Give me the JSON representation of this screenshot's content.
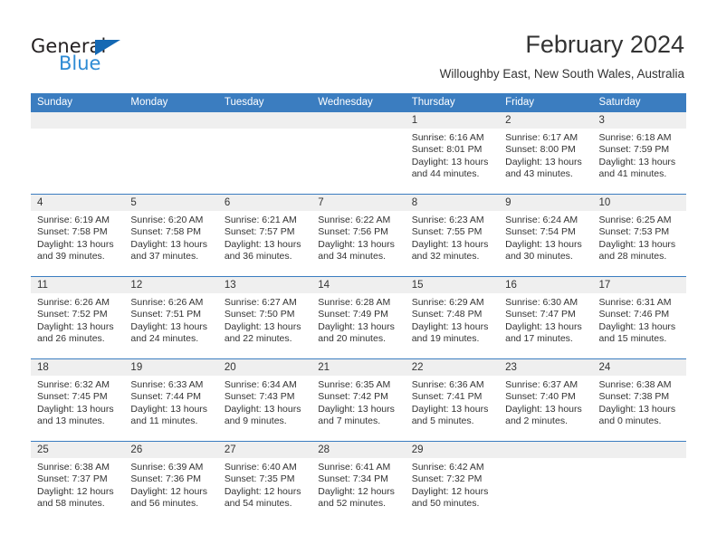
{
  "brand": {
    "name_dark": "General",
    "name_blue": "Blue",
    "accent_blue": "#2e8bd4",
    "triangle_blue": "#1468b3"
  },
  "header": {
    "month_title": "February 2024",
    "location": "Willoughby East, New South Wales, Australia"
  },
  "theme": {
    "header_row_bg": "#3b7dc0",
    "date_band_bg": "#efefef",
    "text_color": "#333333",
    "cell_bg": "#ffffff"
  },
  "weekdays": [
    "Sunday",
    "Monday",
    "Tuesday",
    "Wednesday",
    "Thursday",
    "Friday",
    "Saturday"
  ],
  "weeks": [
    {
      "days": [
        {
          "num": "",
          "lines": [
            "",
            "",
            "",
            ""
          ]
        },
        {
          "num": "",
          "lines": [
            "",
            "",
            "",
            ""
          ]
        },
        {
          "num": "",
          "lines": [
            "",
            "",
            "",
            ""
          ]
        },
        {
          "num": "",
          "lines": [
            "",
            "",
            "",
            ""
          ]
        },
        {
          "num": "1",
          "lines": [
            "Sunrise: 6:16 AM",
            "Sunset: 8:01 PM",
            "Daylight: 13 hours",
            "and 44 minutes."
          ]
        },
        {
          "num": "2",
          "lines": [
            "Sunrise: 6:17 AM",
            "Sunset: 8:00 PM",
            "Daylight: 13 hours",
            "and 43 minutes."
          ]
        },
        {
          "num": "3",
          "lines": [
            "Sunrise: 6:18 AM",
            "Sunset: 7:59 PM",
            "Daylight: 13 hours",
            "and 41 minutes."
          ]
        }
      ]
    },
    {
      "days": [
        {
          "num": "4",
          "lines": [
            "Sunrise: 6:19 AM",
            "Sunset: 7:58 PM",
            "Daylight: 13 hours",
            "and 39 minutes."
          ]
        },
        {
          "num": "5",
          "lines": [
            "Sunrise: 6:20 AM",
            "Sunset: 7:58 PM",
            "Daylight: 13 hours",
            "and 37 minutes."
          ]
        },
        {
          "num": "6",
          "lines": [
            "Sunrise: 6:21 AM",
            "Sunset: 7:57 PM",
            "Daylight: 13 hours",
            "and 36 minutes."
          ]
        },
        {
          "num": "7",
          "lines": [
            "Sunrise: 6:22 AM",
            "Sunset: 7:56 PM",
            "Daylight: 13 hours",
            "and 34 minutes."
          ]
        },
        {
          "num": "8",
          "lines": [
            "Sunrise: 6:23 AM",
            "Sunset: 7:55 PM",
            "Daylight: 13 hours",
            "and 32 minutes."
          ]
        },
        {
          "num": "9",
          "lines": [
            "Sunrise: 6:24 AM",
            "Sunset: 7:54 PM",
            "Daylight: 13 hours",
            "and 30 minutes."
          ]
        },
        {
          "num": "10",
          "lines": [
            "Sunrise: 6:25 AM",
            "Sunset: 7:53 PM",
            "Daylight: 13 hours",
            "and 28 minutes."
          ]
        }
      ]
    },
    {
      "days": [
        {
          "num": "11",
          "lines": [
            "Sunrise: 6:26 AM",
            "Sunset: 7:52 PM",
            "Daylight: 13 hours",
            "and 26 minutes."
          ]
        },
        {
          "num": "12",
          "lines": [
            "Sunrise: 6:26 AM",
            "Sunset: 7:51 PM",
            "Daylight: 13 hours",
            "and 24 minutes."
          ]
        },
        {
          "num": "13",
          "lines": [
            "Sunrise: 6:27 AM",
            "Sunset: 7:50 PM",
            "Daylight: 13 hours",
            "and 22 minutes."
          ]
        },
        {
          "num": "14",
          "lines": [
            "Sunrise: 6:28 AM",
            "Sunset: 7:49 PM",
            "Daylight: 13 hours",
            "and 20 minutes."
          ]
        },
        {
          "num": "15",
          "lines": [
            "Sunrise: 6:29 AM",
            "Sunset: 7:48 PM",
            "Daylight: 13 hours",
            "and 19 minutes."
          ]
        },
        {
          "num": "16",
          "lines": [
            "Sunrise: 6:30 AM",
            "Sunset: 7:47 PM",
            "Daylight: 13 hours",
            "and 17 minutes."
          ]
        },
        {
          "num": "17",
          "lines": [
            "Sunrise: 6:31 AM",
            "Sunset: 7:46 PM",
            "Daylight: 13 hours",
            "and 15 minutes."
          ]
        }
      ]
    },
    {
      "days": [
        {
          "num": "18",
          "lines": [
            "Sunrise: 6:32 AM",
            "Sunset: 7:45 PM",
            "Daylight: 13 hours",
            "and 13 minutes."
          ]
        },
        {
          "num": "19",
          "lines": [
            "Sunrise: 6:33 AM",
            "Sunset: 7:44 PM",
            "Daylight: 13 hours",
            "and 11 minutes."
          ]
        },
        {
          "num": "20",
          "lines": [
            "Sunrise: 6:34 AM",
            "Sunset: 7:43 PM",
            "Daylight: 13 hours",
            "and 9 minutes."
          ]
        },
        {
          "num": "21",
          "lines": [
            "Sunrise: 6:35 AM",
            "Sunset: 7:42 PM",
            "Daylight: 13 hours",
            "and 7 minutes."
          ]
        },
        {
          "num": "22",
          "lines": [
            "Sunrise: 6:36 AM",
            "Sunset: 7:41 PM",
            "Daylight: 13 hours",
            "and 5 minutes."
          ]
        },
        {
          "num": "23",
          "lines": [
            "Sunrise: 6:37 AM",
            "Sunset: 7:40 PM",
            "Daylight: 13 hours",
            "and 2 minutes."
          ]
        },
        {
          "num": "24",
          "lines": [
            "Sunrise: 6:38 AM",
            "Sunset: 7:38 PM",
            "Daylight: 13 hours",
            "and 0 minutes."
          ]
        }
      ]
    },
    {
      "days": [
        {
          "num": "25",
          "lines": [
            "Sunrise: 6:38 AM",
            "Sunset: 7:37 PM",
            "Daylight: 12 hours",
            "and 58 minutes."
          ]
        },
        {
          "num": "26",
          "lines": [
            "Sunrise: 6:39 AM",
            "Sunset: 7:36 PM",
            "Daylight: 12 hours",
            "and 56 minutes."
          ]
        },
        {
          "num": "27",
          "lines": [
            "Sunrise: 6:40 AM",
            "Sunset: 7:35 PM",
            "Daylight: 12 hours",
            "and 54 minutes."
          ]
        },
        {
          "num": "28",
          "lines": [
            "Sunrise: 6:41 AM",
            "Sunset: 7:34 PM",
            "Daylight: 12 hours",
            "and 52 minutes."
          ]
        },
        {
          "num": "29",
          "lines": [
            "Sunrise: 6:42 AM",
            "Sunset: 7:32 PM",
            "Daylight: 12 hours",
            "and 50 minutes."
          ]
        },
        {
          "num": "",
          "lines": [
            "",
            "",
            "",
            ""
          ]
        },
        {
          "num": "",
          "lines": [
            "",
            "",
            "",
            ""
          ]
        }
      ]
    }
  ]
}
